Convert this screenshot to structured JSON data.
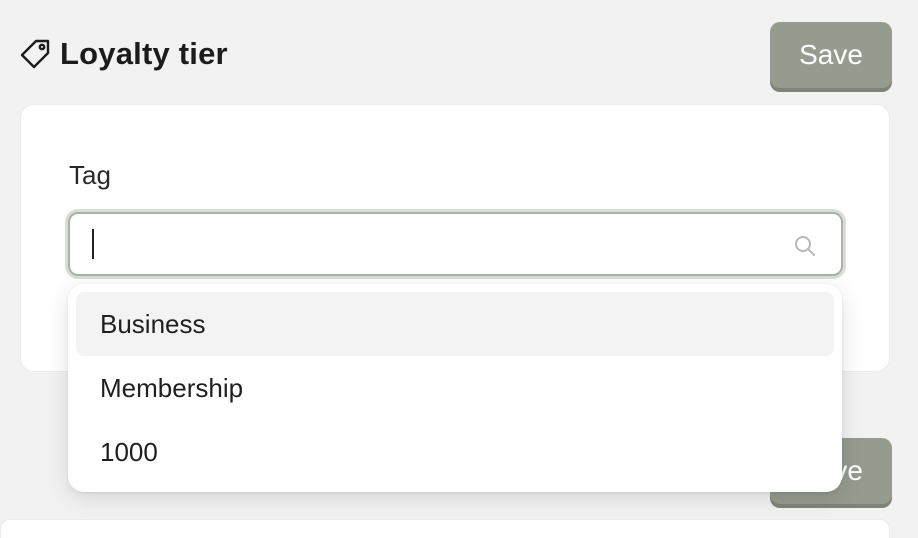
{
  "header": {
    "title": "Loyalty tier",
    "icon": "tag-icon",
    "save_label": "Save"
  },
  "form": {
    "tag_label": "Tag",
    "search": {
      "value": "",
      "placeholder": "",
      "icon": "search-icon"
    }
  },
  "dropdown": {
    "options": [
      {
        "label": "Business",
        "highlighted": true
      },
      {
        "label": "Membership",
        "highlighted": false
      },
      {
        "label": "1000",
        "highlighted": false
      }
    ]
  },
  "footer": {
    "save_label": "Save"
  },
  "colors": {
    "background": "#f2f2f2",
    "button": "#959c8f",
    "focus_border": "#a9b3a3",
    "highlight": "#f3f3f3"
  }
}
